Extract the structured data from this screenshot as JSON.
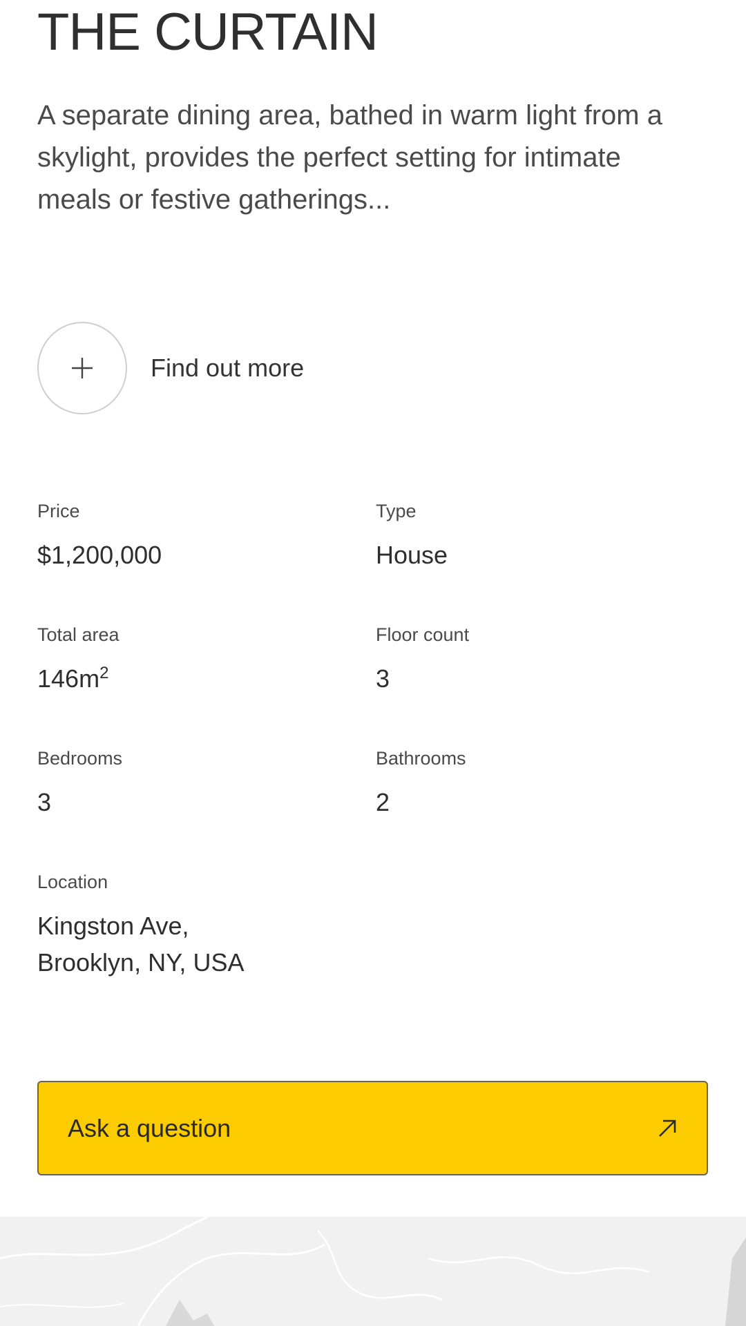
{
  "property": {
    "title": "THE CURTAIN",
    "description": "A separate dining area, bathed in warm light from a skylight, provides the perfect setting for intimate meals or festive gatherings..."
  },
  "find_more": {
    "label": "Find out more",
    "icon": "plus-icon"
  },
  "specs": {
    "price": {
      "label": "Price",
      "value": "$1,200,000"
    },
    "type": {
      "label": "Type",
      "value": "House"
    },
    "total_area": {
      "label": "Total area",
      "value": "146m",
      "unit_sup": "2"
    },
    "floor_count": {
      "label": "Floor count",
      "value": "3"
    },
    "bedrooms": {
      "label": "Bedrooms",
      "value": "3"
    },
    "bathrooms": {
      "label": "Bathrooms",
      "value": "2"
    },
    "location": {
      "label": "Location",
      "line1": "Kingston Ave,",
      "line2": "Brooklyn, NY, USA"
    }
  },
  "cta": {
    "label": "Ask a question",
    "icon": "arrow-up-right-icon",
    "color": "#fccc00"
  },
  "map": {
    "icon": "map-preview"
  }
}
